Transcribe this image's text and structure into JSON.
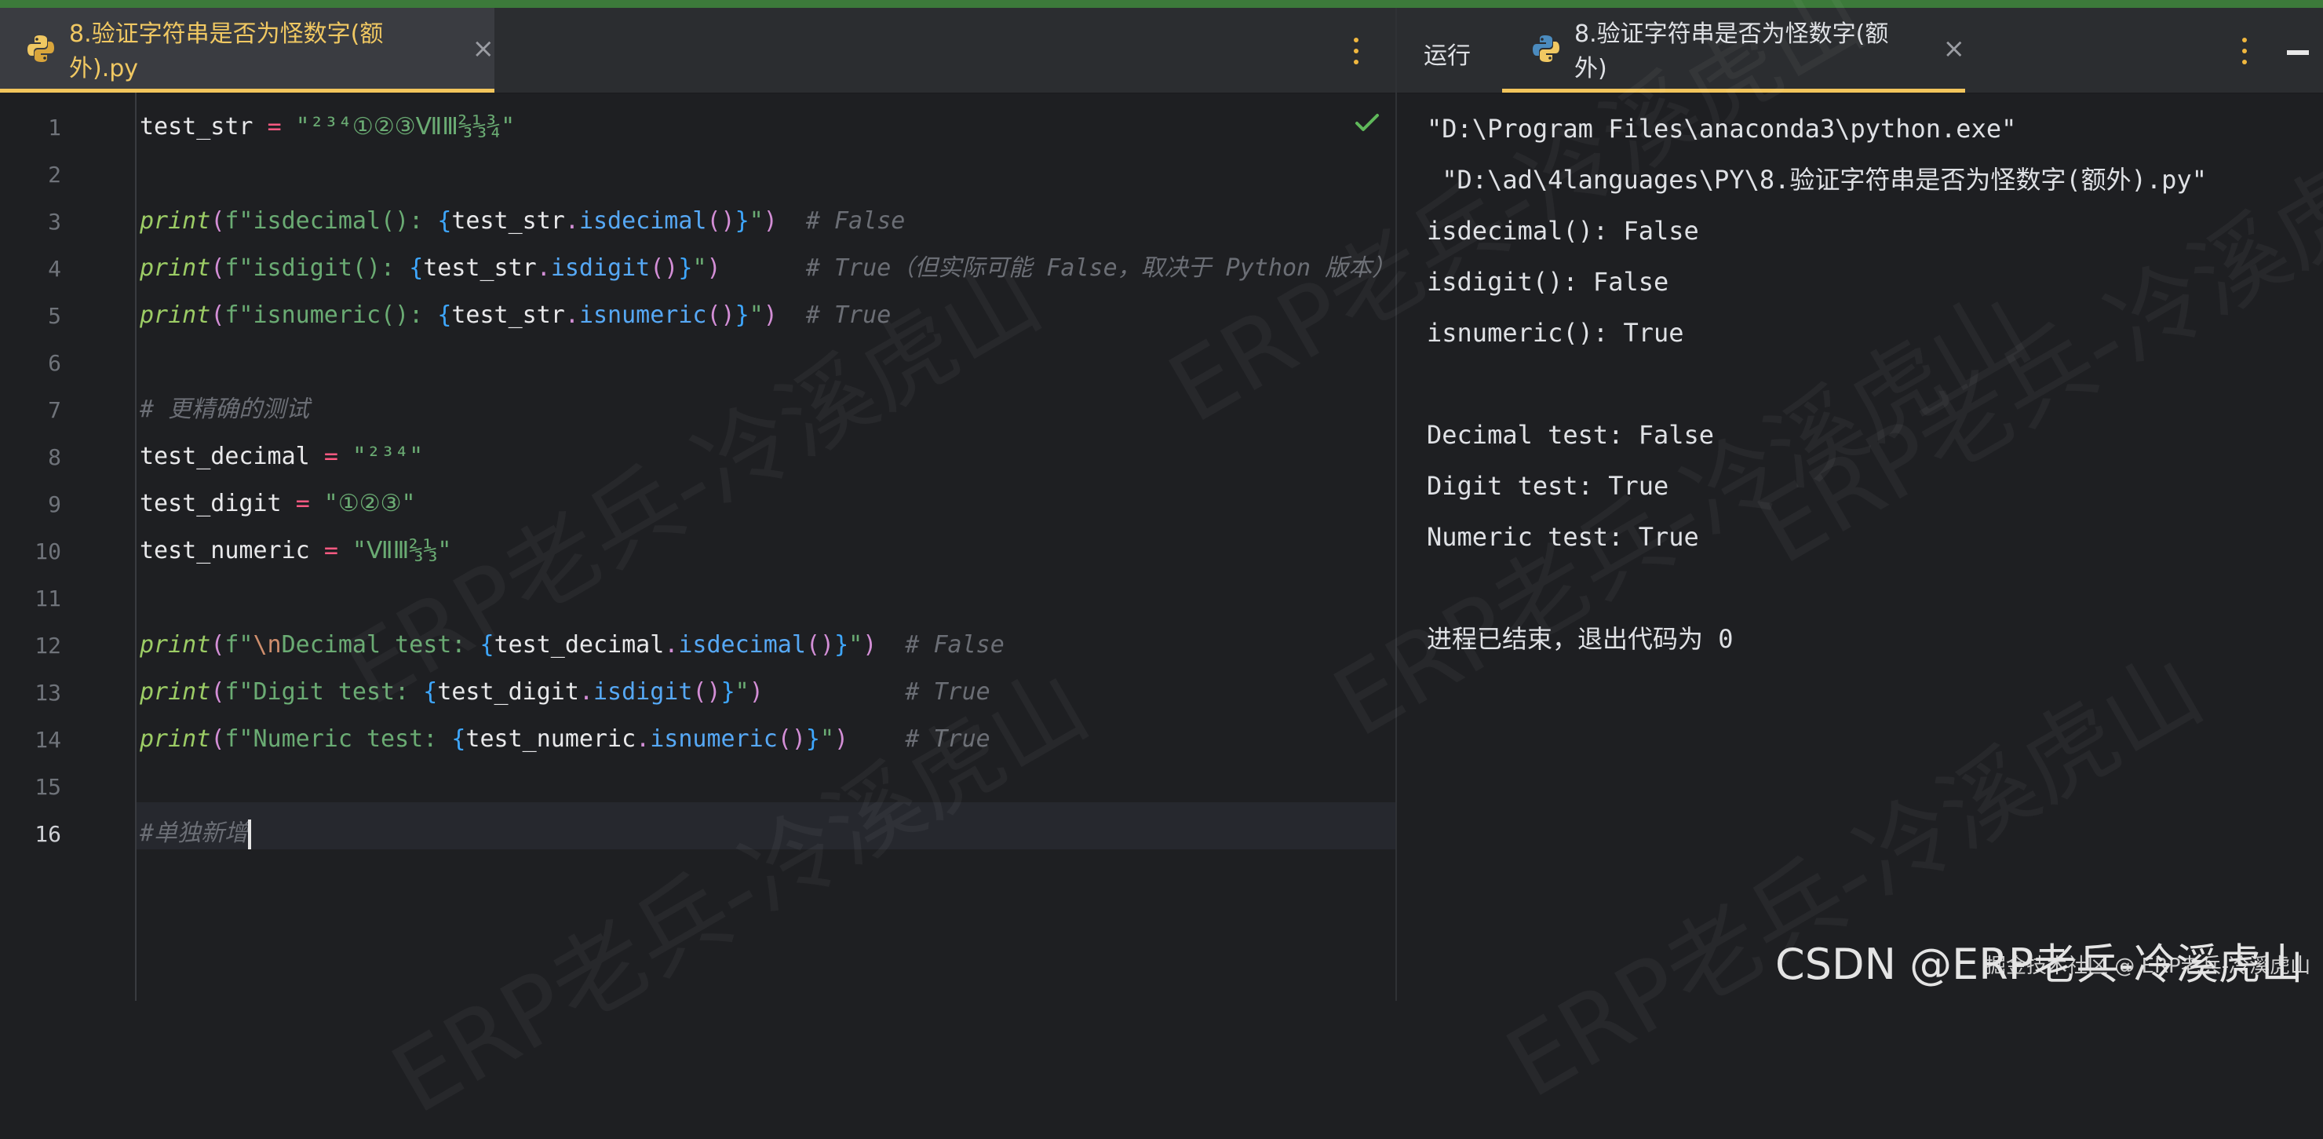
{
  "colors": {
    "accent": "#f2c55c",
    "background": "#1e1f22",
    "tabbar": "#2b2d30",
    "top_strip": "#3c7a3a"
  },
  "editor": {
    "tab": {
      "filename": "8.验证字符串是否为怪数字(额外).py",
      "close": "×",
      "icon": "python-icon"
    },
    "lines": [
      {
        "num": "1",
        "tokens": [
          {
            "c": "plain",
            "t": "test_str "
          },
          {
            "c": "eq",
            "t": "="
          },
          {
            "c": "str",
            "t": " \"²³⁴①②③ⅦⅢ⅔⅓¾\""
          }
        ]
      },
      {
        "num": "2",
        "tokens": []
      },
      {
        "num": "3",
        "tokens": [
          {
            "c": "kw-fn",
            "t": "print"
          },
          {
            "c": "op",
            "t": "("
          },
          {
            "c": "fstr",
            "t": "f\"isdecimal(): "
          },
          {
            "c": "brace",
            "t": "{"
          },
          {
            "c": "plain",
            "t": "test_str"
          },
          {
            "c": "op",
            "t": "."
          },
          {
            "c": "meth",
            "t": "isdecimal"
          },
          {
            "c": "op",
            "t": "()"
          },
          {
            "c": "brace",
            "t": "}"
          },
          {
            "c": "fstr",
            "t": "\""
          },
          {
            "c": "op",
            "t": ")"
          },
          {
            "c": "cmt",
            "t": "  # False"
          }
        ]
      },
      {
        "num": "4",
        "tokens": [
          {
            "c": "kw-fn",
            "t": "print"
          },
          {
            "c": "op",
            "t": "("
          },
          {
            "c": "fstr",
            "t": "f\"isdigit(): "
          },
          {
            "c": "brace",
            "t": "{"
          },
          {
            "c": "plain",
            "t": "test_str"
          },
          {
            "c": "op",
            "t": "."
          },
          {
            "c": "meth",
            "t": "isdigit"
          },
          {
            "c": "op",
            "t": "()"
          },
          {
            "c": "brace",
            "t": "}"
          },
          {
            "c": "fstr",
            "t": "\""
          },
          {
            "c": "op",
            "t": ")"
          },
          {
            "c": "cmt",
            "t": "      # True（但实际可能 False，取决于 Python 版本）"
          }
        ]
      },
      {
        "num": "5",
        "tokens": [
          {
            "c": "kw-fn",
            "t": "print"
          },
          {
            "c": "op",
            "t": "("
          },
          {
            "c": "fstr",
            "t": "f\"isnumeric(): "
          },
          {
            "c": "brace",
            "t": "{"
          },
          {
            "c": "plain",
            "t": "test_str"
          },
          {
            "c": "op",
            "t": "."
          },
          {
            "c": "meth",
            "t": "isnumeric"
          },
          {
            "c": "op",
            "t": "()"
          },
          {
            "c": "brace",
            "t": "}"
          },
          {
            "c": "fstr",
            "t": "\""
          },
          {
            "c": "op",
            "t": ")"
          },
          {
            "c": "cmt",
            "t": "  # True"
          }
        ]
      },
      {
        "num": "6",
        "tokens": []
      },
      {
        "num": "7",
        "tokens": [
          {
            "c": "cmt",
            "t": "# 更精确的测试"
          }
        ]
      },
      {
        "num": "8",
        "tokens": [
          {
            "c": "plain",
            "t": "test_decimal "
          },
          {
            "c": "eq",
            "t": "="
          },
          {
            "c": "str",
            "t": " \"²³⁴\""
          }
        ]
      },
      {
        "num": "9",
        "tokens": [
          {
            "c": "plain",
            "t": "test_digit "
          },
          {
            "c": "eq",
            "t": "="
          },
          {
            "c": "str",
            "t": " \"①②③\""
          }
        ]
      },
      {
        "num": "10",
        "tokens": [
          {
            "c": "plain",
            "t": "test_numeric "
          },
          {
            "c": "eq",
            "t": "="
          },
          {
            "c": "str",
            "t": " \"ⅦⅢ⅔⅓\""
          }
        ]
      },
      {
        "num": "11",
        "tokens": []
      },
      {
        "num": "12",
        "tokens": [
          {
            "c": "kw-fn",
            "t": "print"
          },
          {
            "c": "op",
            "t": "("
          },
          {
            "c": "fstr",
            "t": "f\""
          },
          {
            "c": "esc",
            "t": "\\n"
          },
          {
            "c": "fstr",
            "t": "Decimal test: "
          },
          {
            "c": "brace",
            "t": "{"
          },
          {
            "c": "plain",
            "t": "test_decimal"
          },
          {
            "c": "op",
            "t": "."
          },
          {
            "c": "meth",
            "t": "isdecimal"
          },
          {
            "c": "op",
            "t": "()"
          },
          {
            "c": "brace",
            "t": "}"
          },
          {
            "c": "fstr",
            "t": "\""
          },
          {
            "c": "op",
            "t": ")"
          },
          {
            "c": "cmt",
            "t": "  # False"
          }
        ]
      },
      {
        "num": "13",
        "tokens": [
          {
            "c": "kw-fn",
            "t": "print"
          },
          {
            "c": "op",
            "t": "("
          },
          {
            "c": "fstr",
            "t": "f\"Digit test: "
          },
          {
            "c": "brace",
            "t": "{"
          },
          {
            "c": "plain",
            "t": "test_digit"
          },
          {
            "c": "op",
            "t": "."
          },
          {
            "c": "meth",
            "t": "isdigit"
          },
          {
            "c": "op",
            "t": "()"
          },
          {
            "c": "brace",
            "t": "}"
          },
          {
            "c": "fstr",
            "t": "\""
          },
          {
            "c": "op",
            "t": ")"
          },
          {
            "c": "cmt",
            "t": "          # True"
          }
        ]
      },
      {
        "num": "14",
        "tokens": [
          {
            "c": "kw-fn",
            "t": "print"
          },
          {
            "c": "op",
            "t": "("
          },
          {
            "c": "fstr",
            "t": "f\"Numeric test: "
          },
          {
            "c": "brace",
            "t": "{"
          },
          {
            "c": "plain",
            "t": "test_numeric"
          },
          {
            "c": "op",
            "t": "."
          },
          {
            "c": "meth",
            "t": "isnumeric"
          },
          {
            "c": "op",
            "t": "()"
          },
          {
            "c": "brace",
            "t": "}"
          },
          {
            "c": "fstr",
            "t": "\""
          },
          {
            "c": "op",
            "t": ")"
          },
          {
            "c": "cmt",
            "t": "    # True"
          }
        ]
      },
      {
        "num": "15",
        "tokens": []
      },
      {
        "num": "16",
        "tokens": [
          {
            "c": "cmt",
            "t": "#单独新增"
          }
        ]
      }
    ],
    "current_line": "16"
  },
  "run": {
    "label": "运行",
    "tab": {
      "filename": "8.验证字符串是否为怪数字(额外)",
      "close": "×",
      "icon": "python-icon"
    },
    "output": [
      "\"D:\\Program Files\\anaconda3\\python.exe\"",
      " \"D:\\ad\\4languages\\PY\\8.验证字符串是否为怪数字(额外).py\"",
      "isdecimal(): False",
      "isdigit(): False",
      "isnumeric(): True",
      "",
      "Decimal test: False",
      "Digit test: True",
      "Numeric test: True",
      "",
      "进程已结束，退出代码为 0"
    ]
  },
  "watermark": {
    "text": "ERP老兵-冷溪虎山",
    "repeat": [
      "ERP老兵-冷溪虎山",
      "ERP老兵-冷溪虎山",
      "ERP老兵-冷溪虎山",
      "ERP老兵-冷溪虎山",
      "ERP老兵-冷溪虎山",
      "ERP老兵-冷溪虎山"
    ]
  },
  "footer": {
    "csdn": "CSDN @ERP老兵-冷溪虎山",
    "small": "掘金技术社区 @ ERP老兵-冷溪虎山"
  }
}
